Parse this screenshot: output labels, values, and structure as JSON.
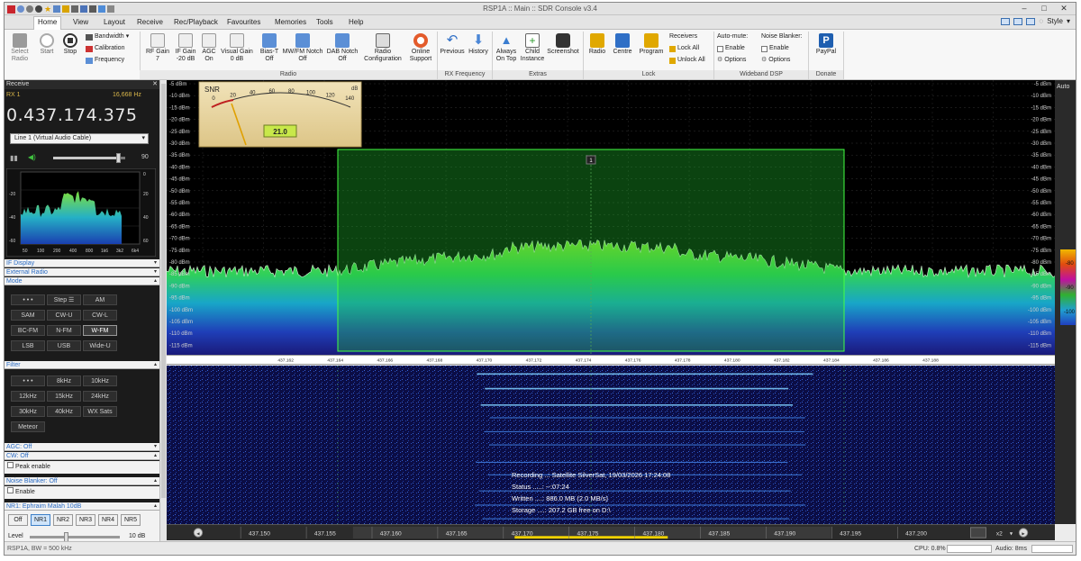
{
  "window": {
    "title": "RSP1A :: Main :: SDR Console v3.4"
  },
  "menu": {
    "tabs": [
      "Home",
      "View",
      "Layout",
      "Receive",
      "Rec/Playback",
      "Favourites",
      "Memories",
      "Tools",
      "Help"
    ],
    "style_label": "Style"
  },
  "ribbon": {
    "select_radio": "Select\nRadio",
    "start": "Start",
    "stop": "Stop",
    "bandwidth": "Bandwidth",
    "calibration": "Calibration",
    "frequency": "Frequency",
    "rf_gain": "RF Gain",
    "rf_gain_val": "7",
    "if_gain": "IF Gain",
    "if_gain_val": "-20 dB",
    "agc": "AGC",
    "agc_val": "On",
    "visual_gain": "Visual Gain",
    "visual_gain_val": "0 dB",
    "bias_t": "Bias-T",
    "bias_t_val": "Off",
    "mwfm_notch": "MW/FM Notch",
    "mwfm_notch_val": "Off",
    "dab_notch": "DAB Notch",
    "dab_notch_val": "Off",
    "radio_config": "Radio\nConfiguration",
    "online_support": "Online\nSupport",
    "group_radio": "Radio",
    "previous": "Previous",
    "history": "History",
    "group_rx_freq": "RX Frequency",
    "always_on_top": "Always\nOn Top",
    "child_instance": "Child\nInstance",
    "screenshot": "Screenshot",
    "group_extras": "Extras",
    "lock_radio": "Radio",
    "lock_centre": "Centre",
    "lock_program": "Program",
    "receivers": "Receivers",
    "lock_all": "Lock All",
    "unlock_all": "Unlock All",
    "group_lock": "Lock",
    "auto_mute": "Auto-mute:",
    "enable1": "Enable",
    "options1": "Options",
    "noise_blanker": "Noise Blanker:",
    "enable2": "Enable",
    "options2": "Options",
    "group_wideband": "Wideband DSP",
    "paypal": "PayPal",
    "group_donate": "Donate"
  },
  "left": {
    "receive_header": "Receive",
    "rx": "RX 1",
    "rx_offset": "16,668 Hz",
    "frequency": "0.437.174.375",
    "audio_device": "Line 1 (Virtual Audio Cable)",
    "volume": "90",
    "mini_y_labels_left": [
      "-20",
      "-40",
      "-60"
    ],
    "mini_y_labels_right": [
      "0",
      "20",
      "40",
      "60"
    ],
    "mini_x_labels": [
      "50",
      "100",
      "200",
      "400",
      "800",
      "1k6",
      "3k2",
      "6k4"
    ],
    "if_display": "IF Display",
    "external_radio": "External Radio",
    "mode": "Mode",
    "mode_buttons": [
      "• • •",
      "Step ☰",
      "AM",
      "SAM",
      "CW-U",
      "CW-L",
      "BC-FM",
      "N-FM",
      "W-FM",
      "LSB",
      "USB",
      "Wide-U"
    ],
    "filter": "Filter",
    "filter_buttons": [
      "• • •",
      "8kHz",
      "10kHz",
      "12kHz",
      "15kHz",
      "24kHz",
      "30kHz",
      "40kHz",
      "WX Sats",
      "Meteor"
    ],
    "agc": "AGC: Off",
    "cw": "CW: Off",
    "peak_enable": "Peak enable",
    "noise_blanker": "Noise Blanker: Off",
    "enable": "Enable",
    "nr": "NR1: Ephraim Malah 10dB",
    "nr_buttons": [
      "Off",
      "NR1",
      "NR2",
      "NR3",
      "NR4",
      "NR5"
    ],
    "level": "Level",
    "level_val": "10 dB"
  },
  "spectrum": {
    "db_labels": [
      "-5 dBm",
      "-10 dBm",
      "-15 dBm",
      "-20 dBm",
      "-25 dBm",
      "-30 dBm",
      "-35 dBm",
      "-40 dBm",
      "-45 dBm",
      "-50 dBm",
      "-55 dBm",
      "-60 dBm",
      "-65 dBm",
      "-70 dBm",
      "-75 dBm",
      "-80 dBm",
      "-85 dBm",
      "-90 dBm",
      "-95 dBm",
      "-100 dBm",
      "-105 dBm",
      "-110 dBm",
      "-115 dBm"
    ],
    "freq_labels": [
      "437.162",
      "437.164",
      "437.166",
      "437.168",
      "437.170",
      "437.172",
      "437.174",
      "437.176",
      "437.178",
      "437.180",
      "437.182",
      "437.184",
      "437.186",
      "437.188"
    ],
    "marker": "1",
    "snr_title": "SNR",
    "snr_db": "dB",
    "snr_scale": [
      "0",
      "20",
      "40",
      "60",
      "80",
      "100",
      "120",
      "140"
    ],
    "snr_value": "21.0",
    "auto_label": "Auto",
    "right_scale": [
      "-80",
      "-90",
      "-100"
    ]
  },
  "waterfall": {
    "recording_lines": [
      "Recording ..: Satellite SilverSat,  19/03/2026 17:24:08",
      "Status .....: --:07:24",
      "Written ....: 886.0 MB (2.0 MB/s)",
      "Storage ....: 207.2 GB free on D:\\"
    ]
  },
  "bottom_axis": {
    "labels": [
      "437.150",
      "437.155",
      "437.160",
      "437.165",
      "437.170",
      "437.175",
      "437.180",
      "437.185",
      "437.190",
      "437.195",
      "437.200"
    ],
    "zoom": "x2"
  },
  "status": {
    "left": "RSP1A, BW = 500 kHz",
    "cpu": "CPU: 0.8%",
    "audio": "Audio: 8ms"
  },
  "colors": {
    "accent": "#2b6cc4",
    "trace": "#2fd05a",
    "filter": "#1fbf2e"
  }
}
